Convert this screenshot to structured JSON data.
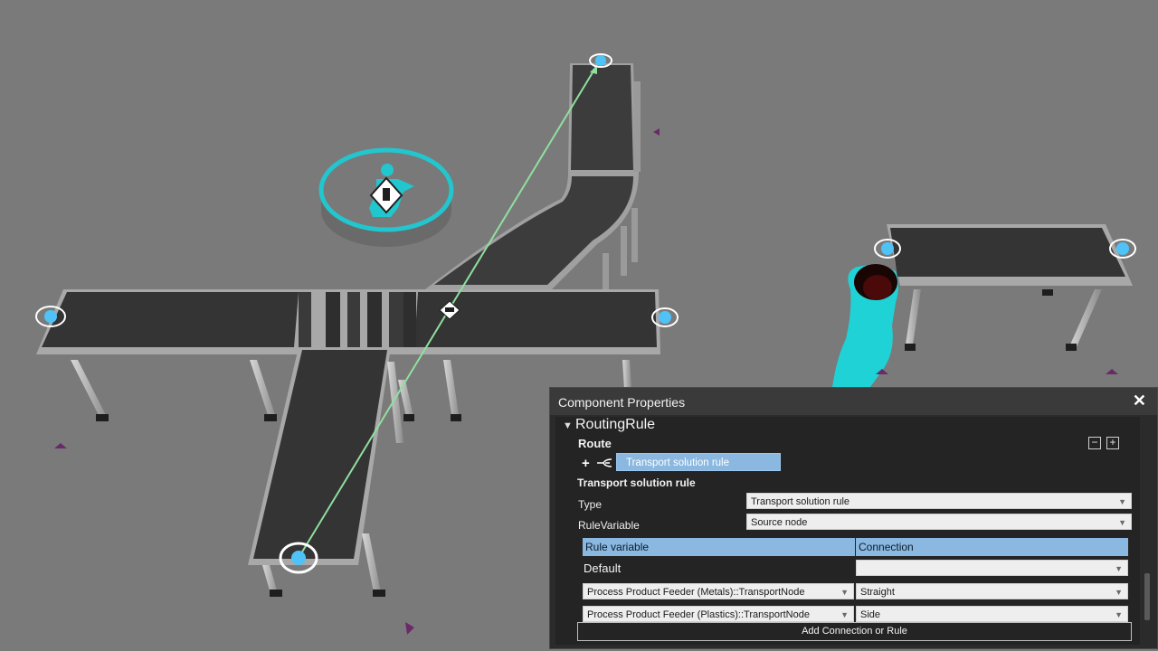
{
  "panel": {
    "title": "Component Properties",
    "close_icon": "close-icon",
    "section": "RoutingRule",
    "route_label": "Route",
    "collapse_button": "−",
    "expand_button": "+",
    "add_route_symbol": "+",
    "route_item": "Transport solution rule",
    "rule_heading": "Transport solution rule",
    "type_label": "Type",
    "type_value": "Transport solution rule",
    "rule_variable_label": "RuleVariable",
    "rule_variable_value": "Source node",
    "table": {
      "headers": [
        "Rule variable",
        "Connection"
      ],
      "default_label": "Default",
      "default_connection": "",
      "rows": [
        {
          "variable": "Process Product Feeder (Metals)::TransportNode",
          "connection": "Straight"
        },
        {
          "variable": "Process Product Feeder (Plastics)::TransportNode",
          "connection": "Side"
        }
      ]
    },
    "add_button": "Add Connection or Rule"
  },
  "colors": {
    "background": "#7a7a7a",
    "conveyor_belt": "#3a3a3a",
    "frame": "#a8a8a8",
    "node": "#4fc3f7",
    "arrow": "#8fe0a0",
    "operator_ring": "#21c4cc",
    "selection_blue": "#8ab8e0"
  }
}
